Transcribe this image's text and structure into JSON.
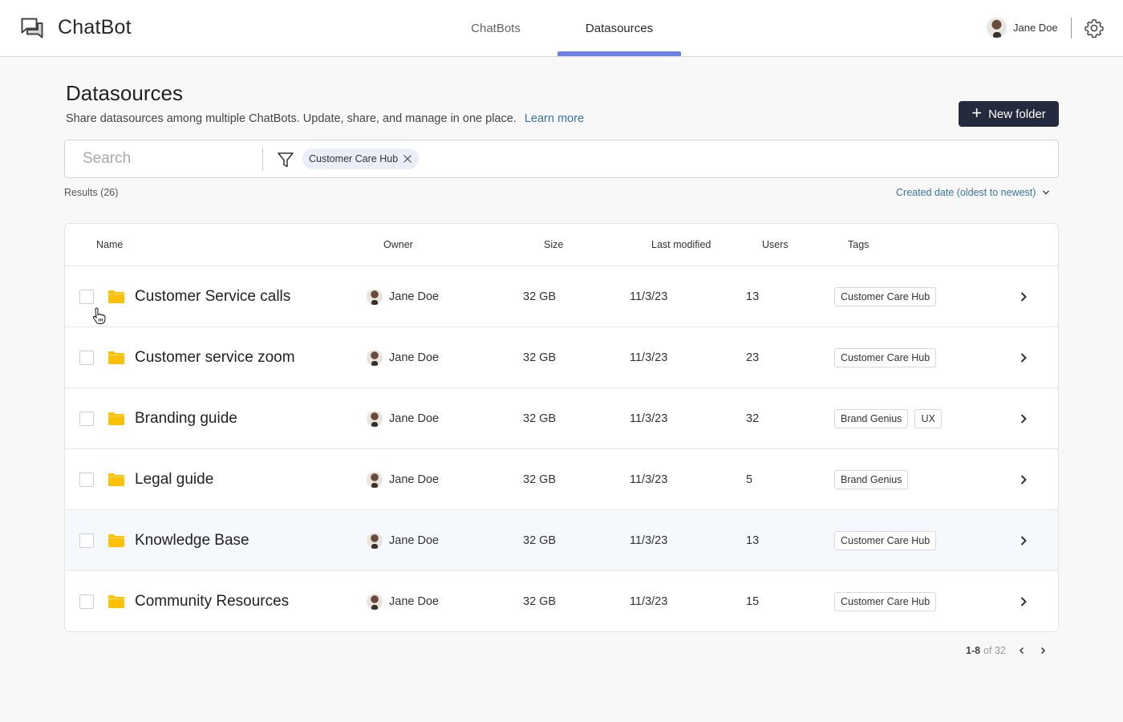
{
  "app": {
    "title": "ChatBot",
    "logo_icon": "chat-bubbles-icon"
  },
  "nav": {
    "tabs": [
      {
        "label": "ChatBots",
        "active": false
      },
      {
        "label": "Datasources",
        "active": true
      }
    ],
    "active_color": "#6d82e0"
  },
  "user": {
    "name": "Jane Doe",
    "avatar_icon": "user-avatar",
    "settings_icon": "gear-icon"
  },
  "page": {
    "title": "Datasources",
    "subtitle": "Share datasources among multiple ChatBots. Update, share, and manage in one place.",
    "learn_more": "Learn more",
    "new_folder_label": "New folder",
    "primary_button_color": "#262a3e"
  },
  "search": {
    "placeholder": "Search",
    "value": "",
    "filter_icon": "filter-icon",
    "active_filters": [
      {
        "label": "Customer Care Hub"
      }
    ]
  },
  "results": {
    "label": "Results (26)",
    "sort_label": "Created date (oldest to newest)"
  },
  "table": {
    "columns": [
      "Name",
      "Owner",
      "Size",
      "Last modified",
      "Users",
      "Tags"
    ],
    "rows": [
      {
        "name": "Customer Service calls",
        "owner": "Jane Doe",
        "size": "32 GB",
        "modified": "11/3/23",
        "users": "13",
        "tags": [
          "Customer Care Hub"
        ],
        "checked": false
      },
      {
        "name": "Customer service zoom",
        "owner": "Jane Doe",
        "size": "32 GB",
        "modified": "11/3/23",
        "users": "23",
        "tags": [
          "Customer Care Hub"
        ],
        "checked": false
      },
      {
        "name": "Branding guide",
        "owner": "Jane Doe",
        "size": "32 GB",
        "modified": "11/3/23",
        "users": "32",
        "tags": [
          "Brand Genius",
          "UX"
        ],
        "checked": false
      },
      {
        "name": "Legal guide",
        "owner": "Jane Doe",
        "size": "32 GB",
        "modified": "11/3/23",
        "users": "5",
        "tags": [
          "Brand Genius"
        ],
        "checked": false
      },
      {
        "name": "Knowledge Base",
        "owner": "Jane Doe",
        "size": "32 GB",
        "modified": "11/3/23",
        "users": "13",
        "tags": [
          "Customer Care Hub"
        ],
        "checked": false,
        "hovered": true
      },
      {
        "name": "Community Resources",
        "owner": "Jane Doe",
        "size": "32 GB",
        "modified": "11/3/23",
        "users": "15",
        "tags": [
          "Customer Care Hub"
        ],
        "checked": false
      }
    ],
    "folder_color": "#ffc107"
  },
  "pagination": {
    "range": "1-8",
    "of_total": "of 32"
  }
}
